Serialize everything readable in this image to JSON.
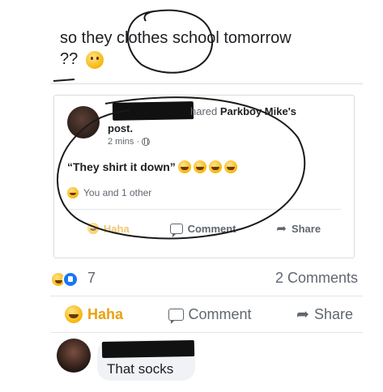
{
  "post": {
    "text": "so they clothes school tomorrow",
    "text_line2": "??",
    "emoji": "thinking-face-emoji"
  },
  "shared": {
    "prefix": "hared",
    "author": "Parkboy Mike's",
    "post_word": "post.",
    "time": "2 mins ·",
    "quote": "“They shirt it down”",
    "reactions_text": "You and 1 other",
    "actions": {
      "haha": "Haha",
      "comment": "Comment",
      "share": "Share"
    }
  },
  "main": {
    "reaction_count": "7",
    "comments_count": "2 Comments",
    "actions": {
      "haha": "Haha",
      "comment": "Comment",
      "share": "Share"
    }
  },
  "comment": {
    "text": "That socks"
  },
  "colors": {
    "haha": "#e9a10e",
    "like": "#1877f2",
    "muted": "#606770",
    "text": "#1c1e21",
    "redaction": "#111111"
  }
}
